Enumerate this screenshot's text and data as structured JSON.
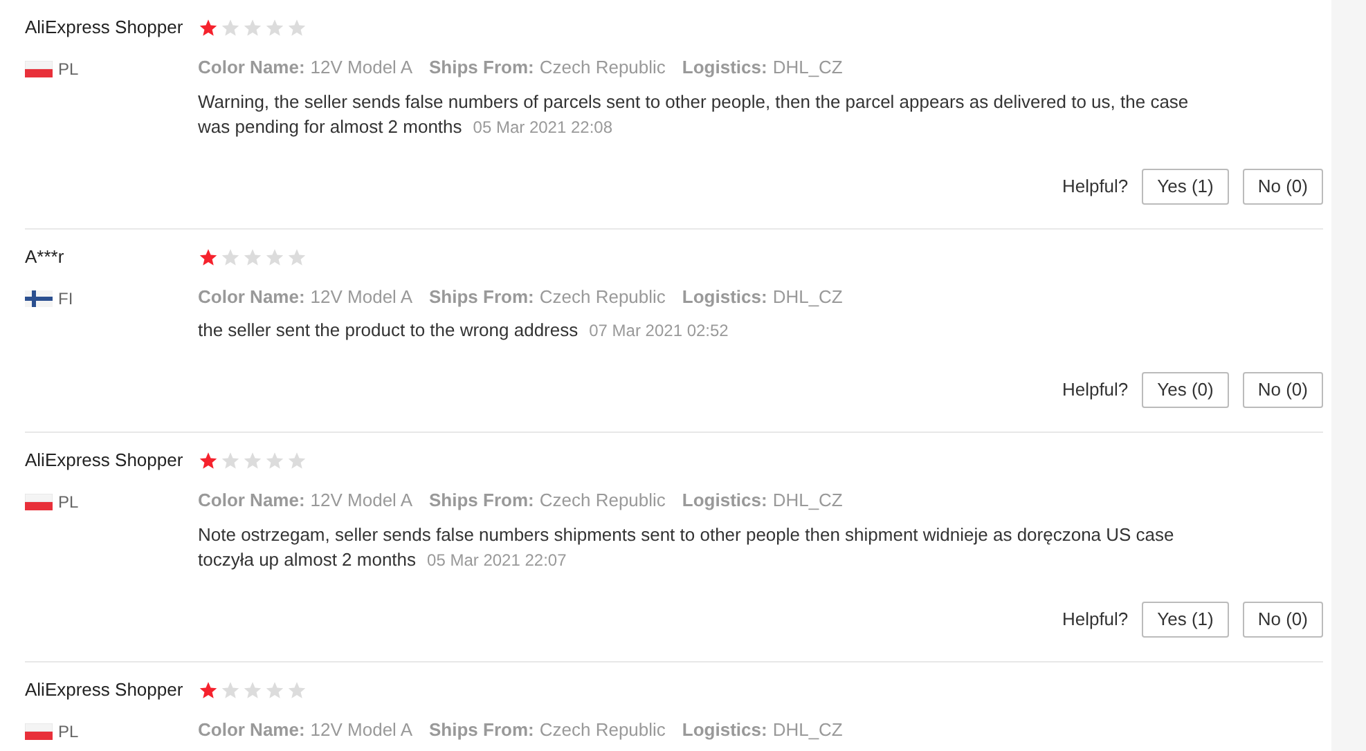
{
  "reviews": [
    {
      "name": "AliExpress Shopper",
      "stars": 1,
      "kind": "pl",
      "country": "PL",
      "attributes": [
        {
          "label": "Color Name:",
          "value": "12V Model A"
        },
        {
          "label": "Ships From:",
          "value": "Czech Republic"
        },
        {
          "label": "Logistics:",
          "value": "DHL_CZ"
        }
      ],
      "text": "Warning, the seller sends false numbers of parcels sent to other people, then the parcel appears as delivered to us, the case was pending for almost 2 months",
      "date": "05 Mar 2021 22:08",
      "helpful_label": "Helpful?",
      "yes": "Yes (1)",
      "no": "No (0)"
    },
    {
      "name": "A***r",
      "stars": 1,
      "kind": "fi",
      "country": "FI",
      "attributes": [
        {
          "label": "Color Name:",
          "value": "12V Model A"
        },
        {
          "label": "Ships From:",
          "value": "Czech Republic"
        },
        {
          "label": "Logistics:",
          "value": "DHL_CZ"
        }
      ],
      "text": "the seller sent the product to the wrong address",
      "date": "07 Mar 2021 02:52",
      "helpful_label": "Helpful?",
      "yes": "Yes (0)",
      "no": "No (0)"
    },
    {
      "name": "AliExpress Shopper",
      "stars": 1,
      "kind": "pl",
      "country": "PL",
      "attributes": [
        {
          "label": "Color Name:",
          "value": "12V Model A"
        },
        {
          "label": "Ships From:",
          "value": "Czech Republic"
        },
        {
          "label": "Logistics:",
          "value": "DHL_CZ"
        }
      ],
      "text": "Note ostrzegam, seller sends false numbers shipments sent to other people then shipment widnieje as doręczona US case toczyła up almost 2 months",
      "date": "05 Mar 2021 22:07",
      "helpful_label": "Helpful?",
      "yes": "Yes (1)",
      "no": "No (0)"
    },
    {
      "name": "AliExpress Shopper",
      "stars": 1,
      "kind": "pl",
      "country": "PL",
      "attributes": [
        {
          "label": "Color Name:",
          "value": "12V Model A"
        },
        {
          "label": "Ships From:",
          "value": "Czech Republic"
        },
        {
          "label": "Logistics:",
          "value": "DHL_CZ"
        }
      ]
    }
  ]
}
